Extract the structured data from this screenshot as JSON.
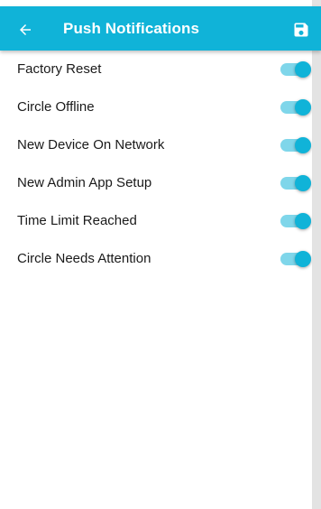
{
  "header": {
    "title": "Push Notifications",
    "back_icon": "arrow-left-icon",
    "save_icon": "save-floppy-icon",
    "background_color": "#10b3d8"
  },
  "notifications": [
    {
      "label": "Factory Reset",
      "enabled": true
    },
    {
      "label": "Circle Offline",
      "enabled": true
    },
    {
      "label": "New Device On Network",
      "enabled": true
    },
    {
      "label": "New Admin App Setup",
      "enabled": true
    },
    {
      "label": "Time Limit Reached",
      "enabled": true
    },
    {
      "label": "Circle Needs Attention",
      "enabled": true
    }
  ],
  "colors": {
    "accent": "#10b3d8",
    "switch_track_on": "#7fd6ea",
    "text": "#1a1a1a",
    "background": "#ffffff"
  }
}
